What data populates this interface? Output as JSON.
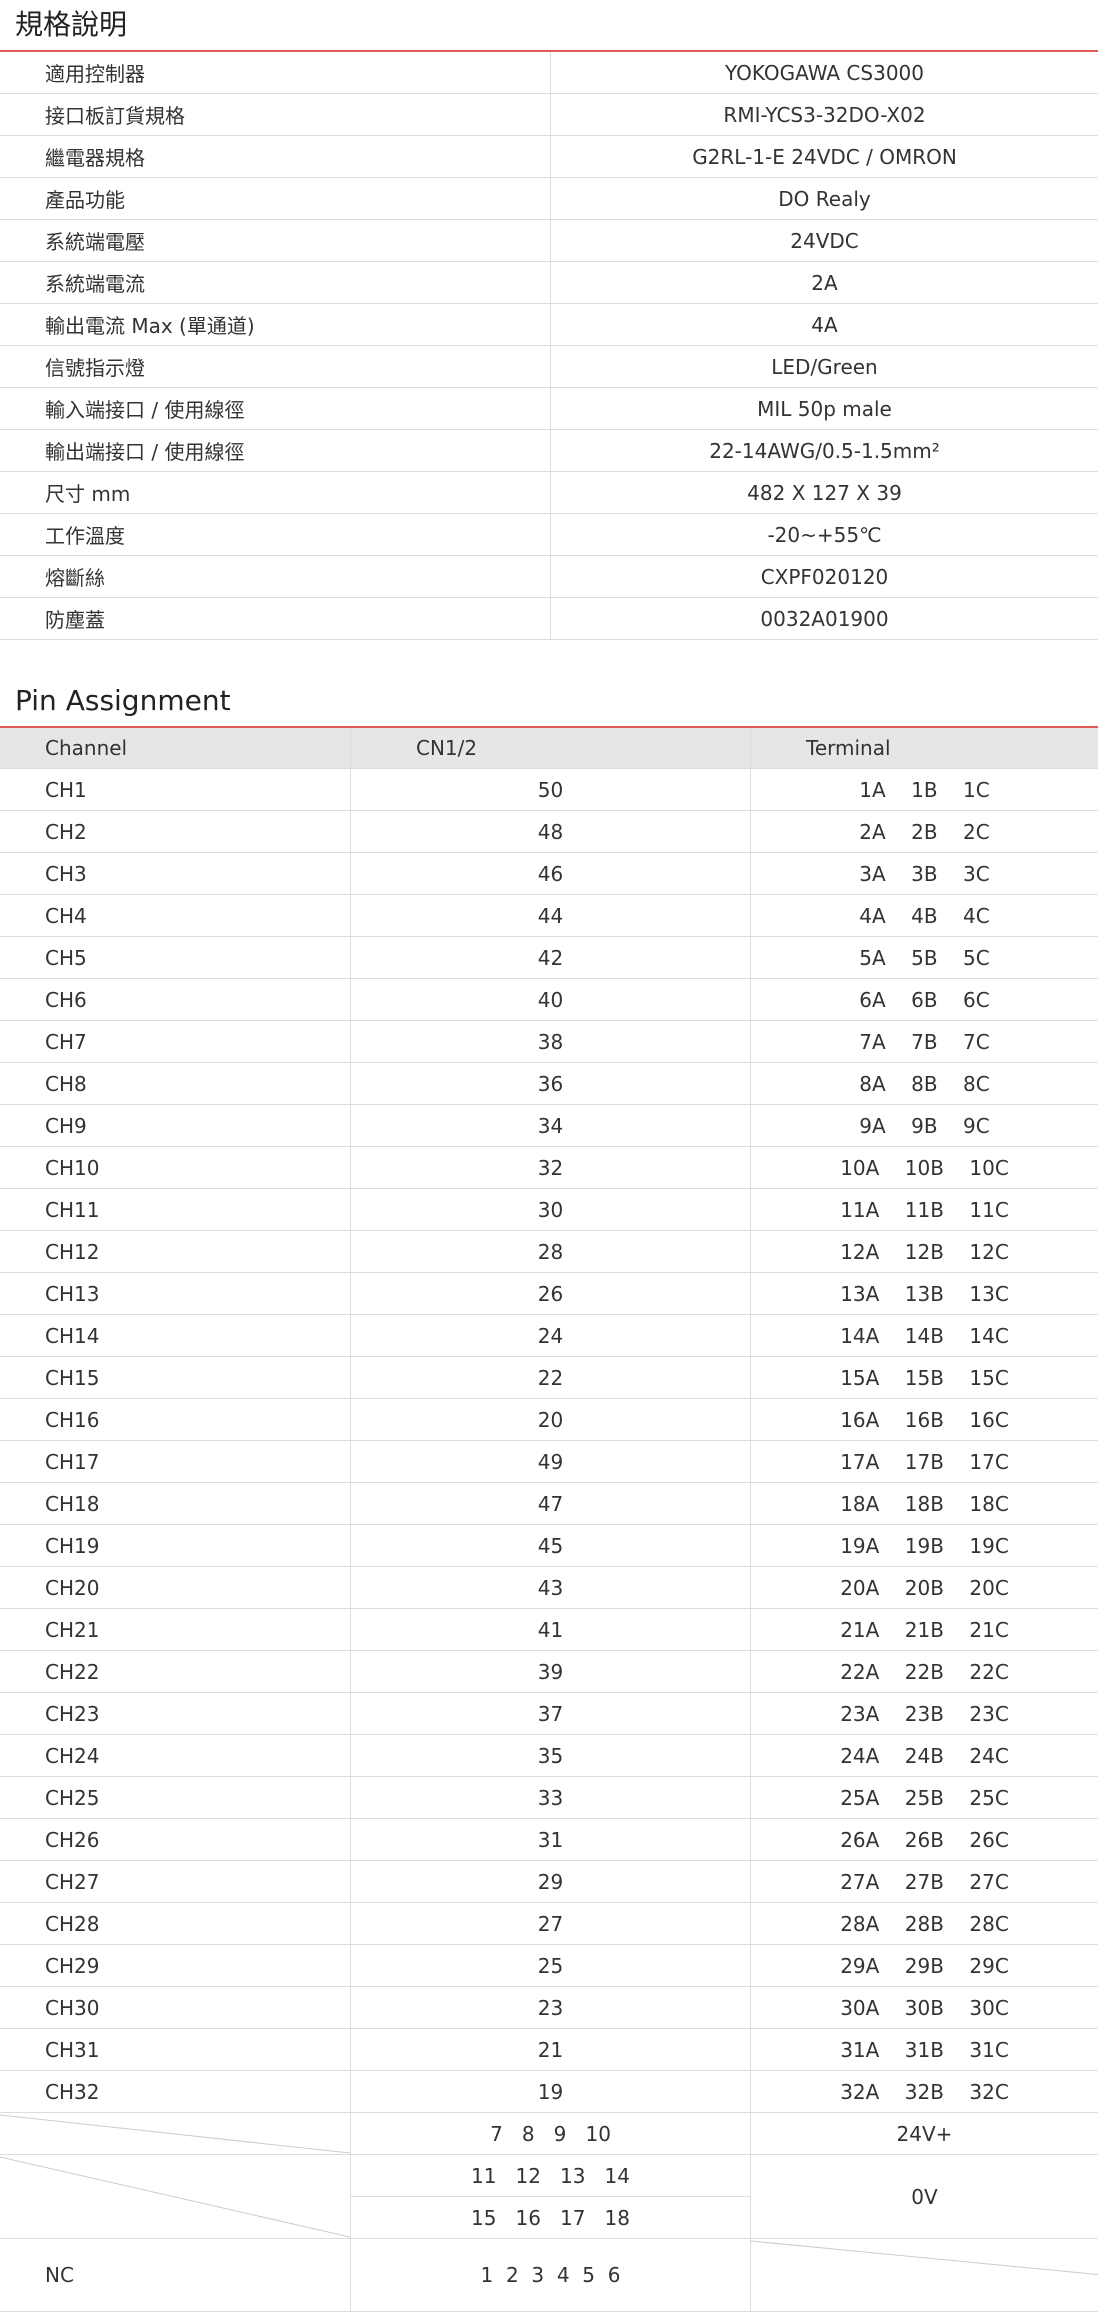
{
  "spec": {
    "title": "規格說明",
    "rows": [
      {
        "label": "適用控制器",
        "value": "YOKOGAWA  CS3000"
      },
      {
        "label": "接口板訂貨規格",
        "value": "RMI-YCS3-32DO-X02"
      },
      {
        "label": "繼電器規格",
        "value": "G2RL-1-E  24VDC / OMRON"
      },
      {
        "label": "產品功能",
        "value": "DO Realy"
      },
      {
        "label": "系統端電壓",
        "value": "24VDC"
      },
      {
        "label": "系統端電流",
        "value": "2A"
      },
      {
        "label": "輸出電流 Max (單通道)",
        "value": "4A"
      },
      {
        "label": "信號指示燈",
        "value": "LED/Green"
      },
      {
        "label": "輸入端接口 / 使用線徑",
        "value": "MIL  50p  male"
      },
      {
        "label": "輸出端接口 / 使用線徑",
        "value": "22-14AWG/0.5-1.5mm²"
      },
      {
        "label": "尺寸 mm",
        "value": "482 X 127 X 39"
      },
      {
        "label": "工作溫度",
        "value": "-20~+55℃"
      },
      {
        "label": "熔斷絲",
        "value": "CXPF020120"
      },
      {
        "label": "防塵蓋",
        "value": "0032A01900"
      }
    ]
  },
  "pins": {
    "title": "Pin Assignment",
    "headers": [
      "Channel",
      "CN1/2",
      "Terminal"
    ],
    "rows": [
      {
        "ch": "CH1",
        "cn": "50",
        "term": "1A    1B    1C"
      },
      {
        "ch": "CH2",
        "cn": "48",
        "term": "2A    2B    2C"
      },
      {
        "ch": "CH3",
        "cn": "46",
        "term": "3A    3B    3C"
      },
      {
        "ch": "CH4",
        "cn": "44",
        "term": "4A    4B    4C"
      },
      {
        "ch": "CH5",
        "cn": "42",
        "term": "5A    5B    5C"
      },
      {
        "ch": "CH6",
        "cn": "40",
        "term": "6A    6B    6C"
      },
      {
        "ch": "CH7",
        "cn": "38",
        "term": "7A    7B    7C"
      },
      {
        "ch": "CH8",
        "cn": "36",
        "term": "8A    8B    8C"
      },
      {
        "ch": "CH9",
        "cn": "34",
        "term": "9A    9B    9C"
      },
      {
        "ch": "CH10",
        "cn": "32",
        "term": "10A    10B    10C"
      },
      {
        "ch": "CH11",
        "cn": "30",
        "term": "11A    11B    11C"
      },
      {
        "ch": "CH12",
        "cn": "28",
        "term": "12A    12B    12C"
      },
      {
        "ch": "CH13",
        "cn": "26",
        "term": "13A    13B    13C"
      },
      {
        "ch": "CH14",
        "cn": "24",
        "term": "14A    14B    14C"
      },
      {
        "ch": "CH15",
        "cn": "22",
        "term": "15A    15B    15C"
      },
      {
        "ch": "CH16",
        "cn": "20",
        "term": "16A    16B    16C"
      },
      {
        "ch": "CH17",
        "cn": "49",
        "term": "17A    17B    17C"
      },
      {
        "ch": "CH18",
        "cn": "47",
        "term": "18A    18B    18C"
      },
      {
        "ch": "CH19",
        "cn": "45",
        "term": "19A    19B    19C"
      },
      {
        "ch": "CH20",
        "cn": "43",
        "term": "20A    20B    20C"
      },
      {
        "ch": "CH21",
        "cn": "41",
        "term": "21A    21B    21C"
      },
      {
        "ch": "CH22",
        "cn": "39",
        "term": "22A    22B    22C"
      },
      {
        "ch": "CH23",
        "cn": "37",
        "term": "23A    23B    23C"
      },
      {
        "ch": "CH24",
        "cn": "35",
        "term": "24A    24B    24C"
      },
      {
        "ch": "CH25",
        "cn": "33",
        "term": "25A    25B    25C"
      },
      {
        "ch": "CH26",
        "cn": "31",
        "term": "26A    26B    26C"
      },
      {
        "ch": "CH27",
        "cn": "29",
        "term": "27A    27B    27C"
      },
      {
        "ch": "CH28",
        "cn": "27",
        "term": "28A    28B    28C"
      },
      {
        "ch": "CH29",
        "cn": "25",
        "term": "29A    29B    29C"
      },
      {
        "ch": "CH30",
        "cn": "23",
        "term": "30A    30B    30C"
      },
      {
        "ch": "CH31",
        "cn": "21",
        "term": "31A    31B    31C"
      },
      {
        "ch": "CH32",
        "cn": "19",
        "term": "32A    32B    32C"
      }
    ],
    "power": {
      "v24_pins": "7   8   9   10",
      "v24_label": "24V+",
      "ov_pins_a": "11   12   13   14",
      "ov_pins_b": "15   16   17   18",
      "ov_label": "0V",
      "nc_label": "NC",
      "nc_pins": "1  2  3  4  5  6"
    }
  }
}
